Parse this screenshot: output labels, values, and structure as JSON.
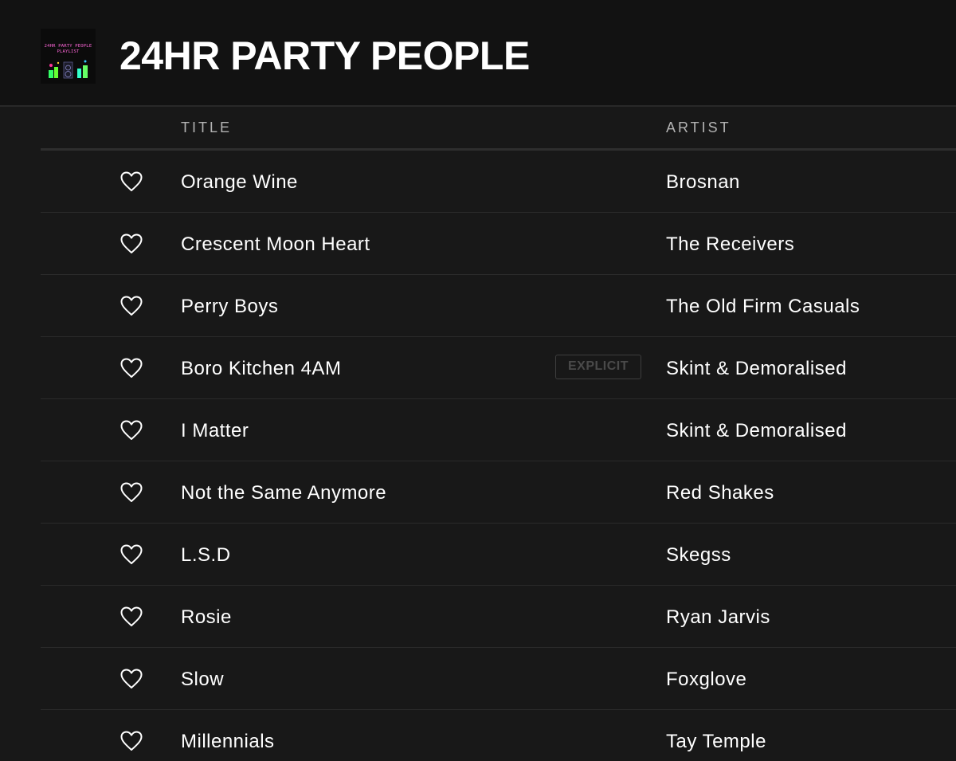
{
  "playlist": {
    "title": "24HR PARTY PEOPLE",
    "cover_text_line1": "24HR PARTY PEOPLE",
    "cover_text_line2": "PLAYLIST"
  },
  "columns": {
    "title": "TITLE",
    "artist": "ARTIST"
  },
  "tracks": [
    {
      "title": "Orange Wine",
      "artist": "Brosnan",
      "explicit": false
    },
    {
      "title": "Crescent Moon Heart",
      "artist": "The Receivers",
      "explicit": false
    },
    {
      "title": "Perry Boys",
      "artist": "The Old Firm Casuals",
      "explicit": false
    },
    {
      "title": "Boro Kitchen 4AM",
      "artist": "Skint & Demoralised",
      "explicit": true
    },
    {
      "title": "I Matter",
      "artist": "Skint & Demoralised",
      "explicit": false
    },
    {
      "title": "Not the Same Anymore",
      "artist": "Red Shakes",
      "explicit": false
    },
    {
      "title": "L.S.D",
      "artist": "Skegss",
      "explicit": false
    },
    {
      "title": "Rosie",
      "artist": "Ryan Jarvis",
      "explicit": false
    },
    {
      "title": "Slow",
      "artist": "Foxglove",
      "explicit": false
    },
    {
      "title": "Millennials",
      "artist": "Tay Temple",
      "explicit": false
    }
  ],
  "explicit_label": "EXPLICIT",
  "icons": {
    "like": "heart-outline-icon"
  },
  "colors": {
    "background": "#181818",
    "header": "#121212",
    "text": "#ffffff",
    "muted": "#b3b3b3",
    "cover_accent": "#ff66d9"
  }
}
